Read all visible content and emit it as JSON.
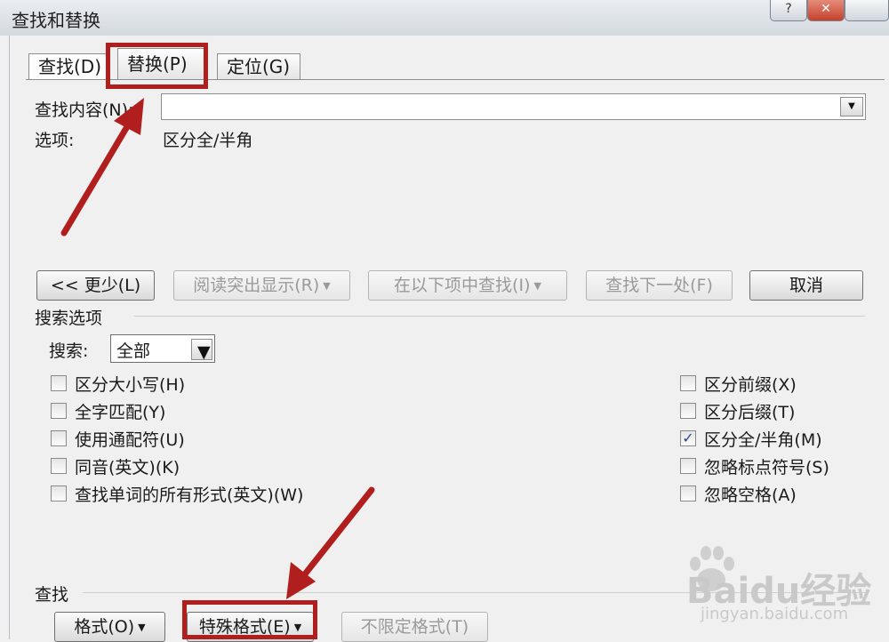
{
  "window": {
    "title": "查找和替换",
    "help_icon": "?"
  },
  "tabs": [
    {
      "label": "查找(D)"
    },
    {
      "label": "替换(P)"
    },
    {
      "label": "定位(G)"
    }
  ],
  "find": {
    "label": "查找内容(N):",
    "value": "",
    "options_label": "选项:",
    "options_value": "区分全/半角"
  },
  "buttons": {
    "less": "<< 更少(L)",
    "reading_highlight": "阅读突出显示(R)",
    "find_in": "在以下项中查找(I)",
    "find_next": "查找下一处(F)",
    "cancel": "取消",
    "format": "格式(O)",
    "special": "特殊格式(E)",
    "no_format": "不限定格式(T)"
  },
  "search_options": {
    "title": "搜索选项",
    "search_label": "搜索:",
    "search_value": "全部",
    "left": [
      {
        "label": "区分大小写(H)",
        "checked": false
      },
      {
        "label": "全字匹配(Y)",
        "checked": false
      },
      {
        "label": "使用通配符(U)",
        "checked": false
      },
      {
        "label": "同音(英文)(K)",
        "checked": false
      },
      {
        "label": "查找单词的所有形式(英文)(W)",
        "checked": false
      }
    ],
    "right": [
      {
        "label": "区分前缀(X)",
        "checked": false
      },
      {
        "label": "区分后缀(T)",
        "checked": false
      },
      {
        "label": "区分全/半角(M)",
        "checked": true
      },
      {
        "label": "忽略标点符号(S)",
        "checked": false
      },
      {
        "label": "忽略空格(A)",
        "checked": false
      }
    ]
  },
  "find_section": {
    "title": "查找"
  },
  "watermark": {
    "brand": "Baidu经验",
    "url": "jingyan.baidu.com"
  },
  "colors": {
    "annotation_red": "#b11e1e",
    "check_blue": "#2a4a8a"
  }
}
